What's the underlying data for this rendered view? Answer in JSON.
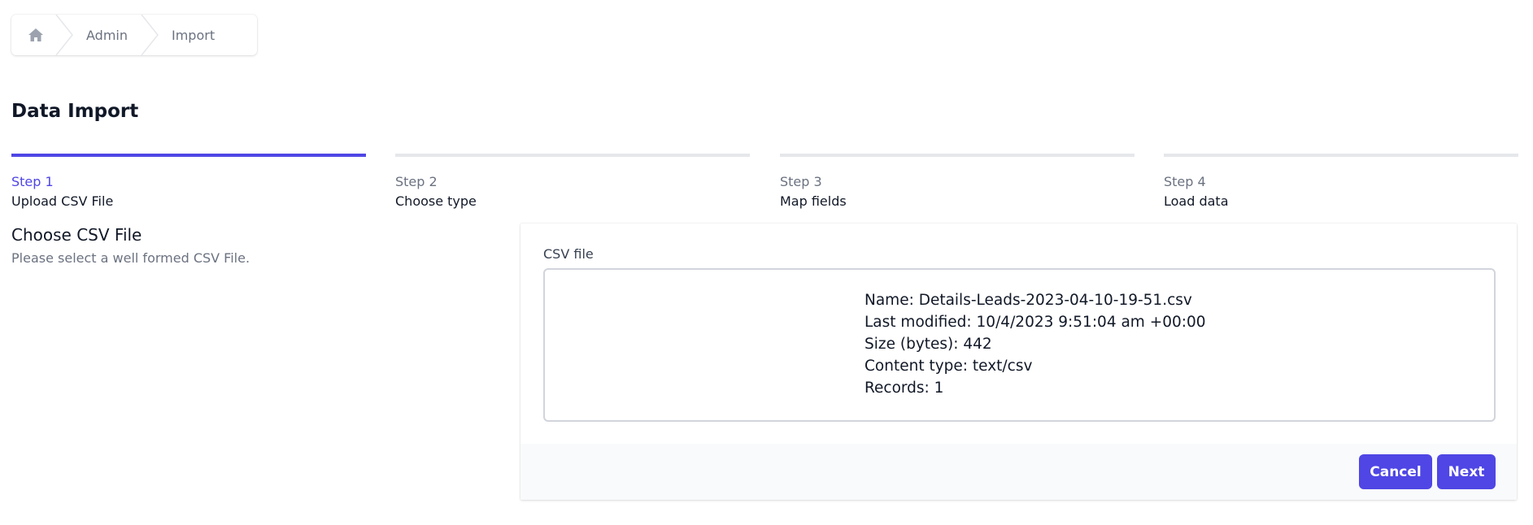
{
  "breadcrumb": {
    "home_icon": "home-icon",
    "items": [
      {
        "label": "Admin"
      },
      {
        "label": "Import"
      }
    ]
  },
  "page": {
    "title": "Data Import"
  },
  "steps": [
    {
      "number": "Step 1",
      "name": "Upload CSV File",
      "active": true
    },
    {
      "number": "Step 2",
      "name": "Choose type",
      "active": false
    },
    {
      "number": "Step 3",
      "name": "Map fields",
      "active": false
    },
    {
      "number": "Step 4",
      "name": "Load data",
      "active": false
    }
  ],
  "section": {
    "title": "Choose CSV File",
    "description": "Please select a well formed CSV File."
  },
  "form": {
    "field_label": "CSV file",
    "file_info": {
      "name": "Name: Details-Leads-2023-04-10-19-51.csv",
      "last_modified": "Last modified: 10/4/2023 9:51:04 am +00:00",
      "size": "Size (bytes): 442",
      "content_type": "Content type: text/csv",
      "records": "Records: 1"
    }
  },
  "actions": {
    "cancel_label": "Cancel",
    "next_label": "Next"
  },
  "colors": {
    "accent": "#4f46e5",
    "inactive_bar": "#e5e7eb",
    "muted_text": "#6b7280",
    "footer_bg": "#f9fafb"
  }
}
